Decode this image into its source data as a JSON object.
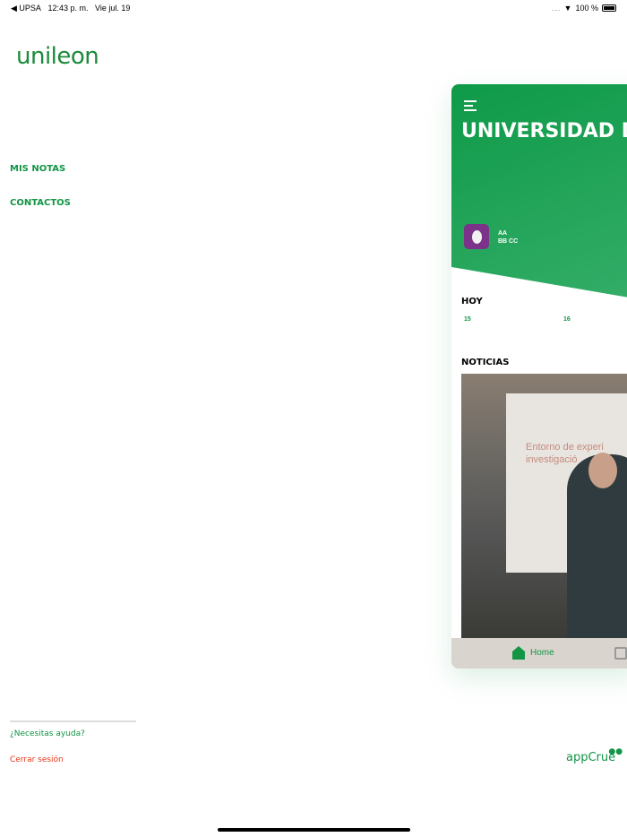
{
  "status_bar": {
    "back_app": "◀ UPSA",
    "time": "12:43 p. m.",
    "date": "Vie jul. 19",
    "signal": "....",
    "battery": "100 %"
  },
  "sidebar": {
    "logo": "unileon",
    "items": [
      {
        "label": "MIS NOTAS"
      },
      {
        "label": "CONTACTOS"
      }
    ],
    "help": "¿Necesitas ayuda?",
    "logout": "Cerrar sesión",
    "brand": "appCrue"
  },
  "card": {
    "title": "UNIVERSIDAD DE",
    "user_line1": "AA",
    "user_line2": "BB CC",
    "today_label": "HOY",
    "days": [
      "15",
      "16"
    ],
    "news_label": "NOTICIAS",
    "news_image_text": "Entorno de experi investigació",
    "tabs": [
      {
        "label": "Home"
      }
    ]
  }
}
